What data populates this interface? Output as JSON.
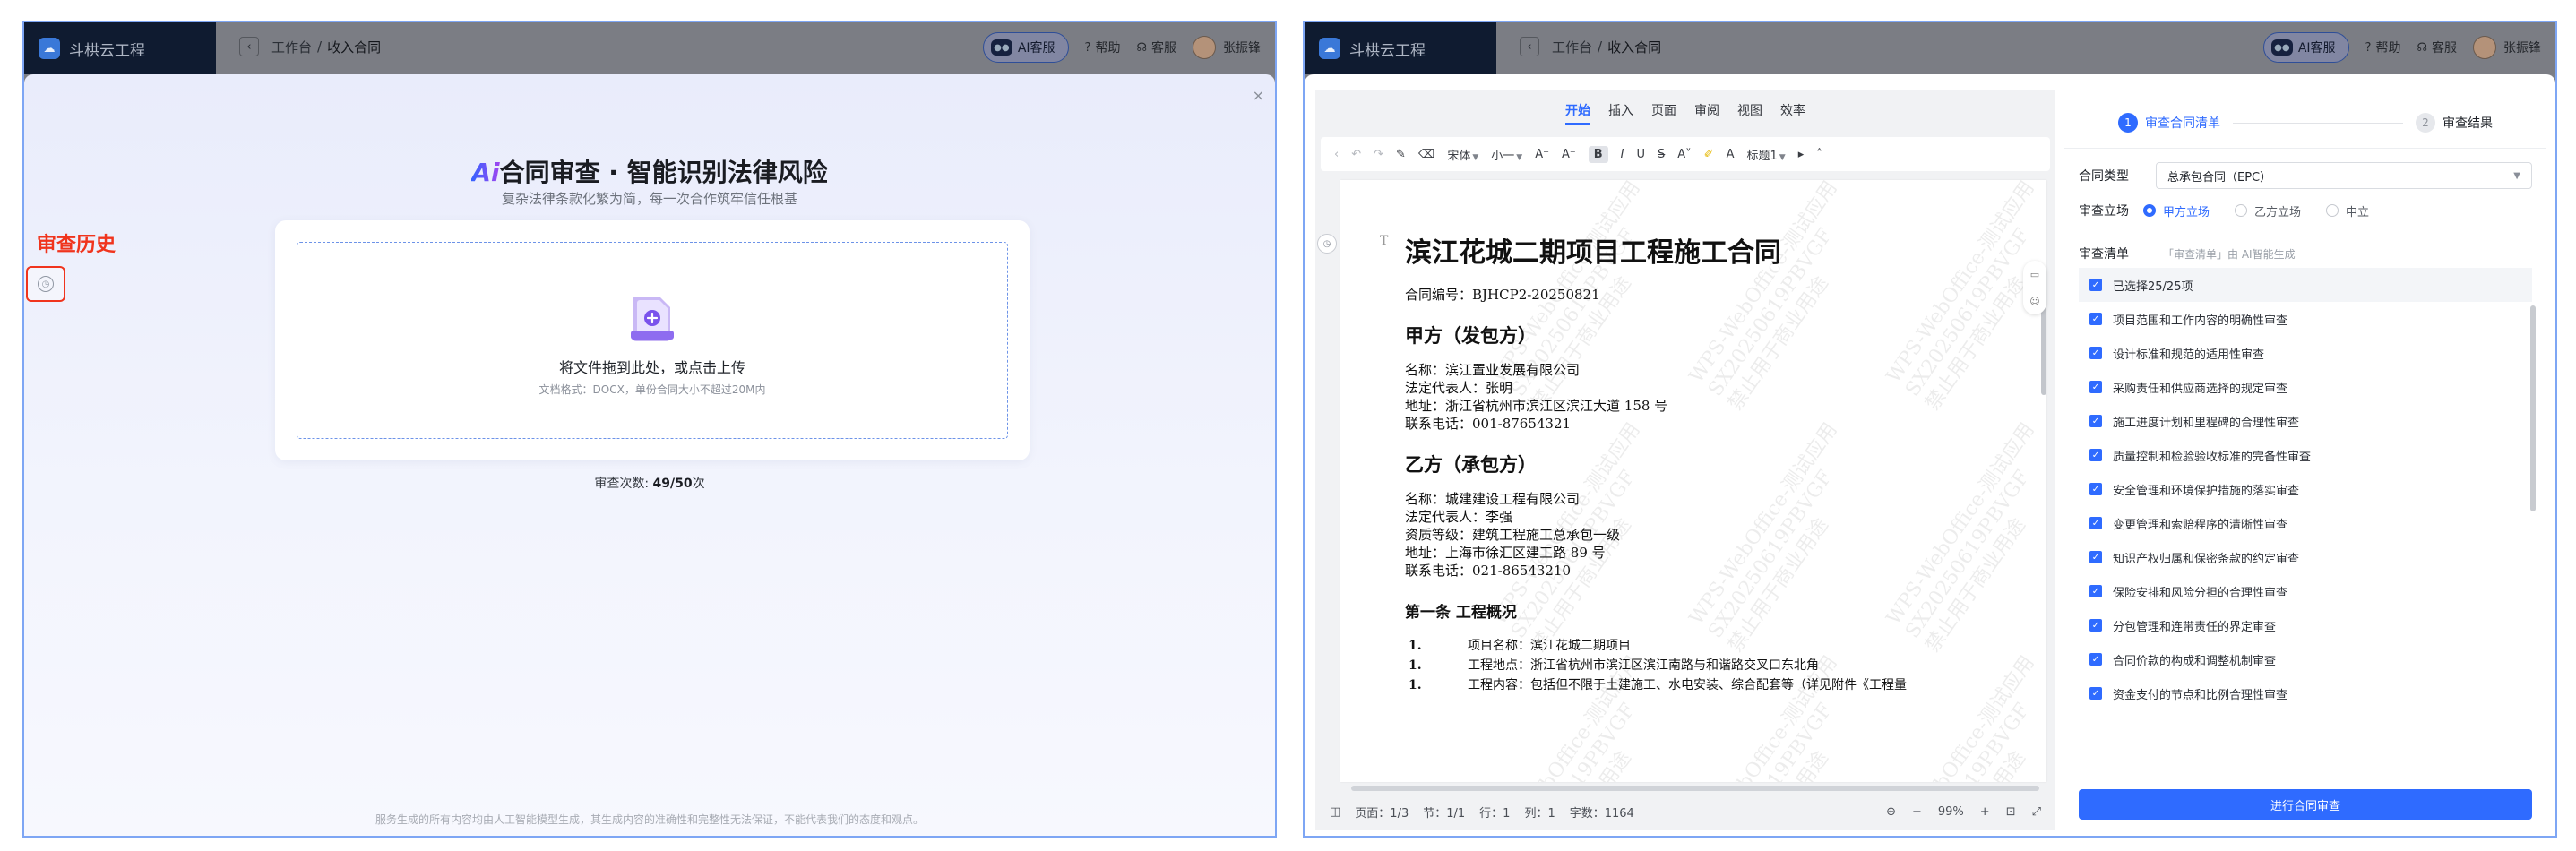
{
  "app": {
    "brand": "斗栱云工程",
    "breadcrumb": [
      "工作台",
      "收入合同"
    ],
    "ai_service": "AI客服",
    "help": "帮助",
    "service": "客服",
    "user": "张振锋"
  },
  "upload_view": {
    "title_ai": "Ai",
    "title_rest": "合同审查 · 智能识别法律风险",
    "subtitle": "复杂法律条款化繁为简，每一次合作筑牢信任根基",
    "history_label": "审查历史",
    "upload_text": "将文件拖到此处，或点击上传",
    "upload_hint": "文档格式：DOCX，单份合同大小不超过20M内",
    "review_count_label": "审查次数: ",
    "review_count_value": "49/50",
    "review_count_unit": "次",
    "footer": "服务生成的所有内容均由人工智能模型生成，其生成内容的准确性和完整性无法保证，不能代表我们的态度和观点。"
  },
  "editor": {
    "tabs": [
      "开始",
      "插入",
      "页面",
      "审阅",
      "视图",
      "效率"
    ],
    "active_tab": "开始",
    "font": "宋体",
    "font_size": "小一",
    "heading": "标题1",
    "watermark": [
      "WPS-WebOffice-测试应用",
      "SX20250619PBVGF",
      "禁止用于商业用途"
    ],
    "doc": {
      "title": "滨江花城二期项目工程施工合同",
      "contract_no": "合同编号：BJHCP2-20250821",
      "party_a_heading": "甲方（发包方）",
      "party_a": [
        "名称：滨江置业发展有限公司",
        "法定代表人：张明",
        "地址：浙江省杭州市滨江区滨江大道 158 号",
        "联系电话：001-87654321"
      ],
      "party_b_heading": "乙方（承包方）",
      "party_b": [
        "名称：城建建设工程有限公司",
        "法定代表人：李强",
        "资质等级：建筑工程施工总承包一级",
        "地址：上海市徐汇区建工路 89 号",
        "联系电话：021-86543210"
      ],
      "article_heading": "第一条 工程概况",
      "article_items": [
        {
          "n": "1.",
          "t": "项目名称：滨江花城二期项目"
        },
        {
          "n": "1.",
          "t": "工程地点：浙江省杭州市滨江区滨江南路与和谐路交叉口东北角"
        },
        {
          "n": "1.",
          "t": "工程内容：包括但不限于土建施工、水电安装、综合配套等（详见附件《工程量"
        }
      ]
    },
    "status": {
      "page": "页面：1/3",
      "section": "节：1/1",
      "row": "行：1",
      "col": "列：1",
      "words": "字数：1164",
      "zoom": "99%"
    }
  },
  "review_panel": {
    "step1": {
      "num": "1",
      "label": "审查合同清单"
    },
    "step2": {
      "num": "2",
      "label": "审查结果"
    },
    "contract_type_label": "合同类型",
    "contract_type_value": "总承包合同（EPC）",
    "position_label": "审查立场",
    "positions": [
      "甲方立场",
      "乙方立场",
      "中立"
    ],
    "selected_position": "甲方立场",
    "list_label": "审查清单",
    "list_hint": "「审查清单」由 AI智能生成",
    "selected_summary": "已选择25/25项",
    "items": [
      "项目范围和工作内容的明确性审查",
      "设计标准和规范的适用性审查",
      "采购责任和供应商选择的规定审查",
      "施工进度计划和里程碑的合理性审查",
      "质量控制和检验验收标准的完备性审查",
      "安全管理和环境保护措施的落实审查",
      "变更管理和索赔程序的清晰性审查",
      "知识产权归属和保密条款的约定审查",
      "保险安排和风险分担的合理性审查",
      "分包管理和连带责任的界定审查",
      "合同价款的构成和调整机制审查",
      "资金支付的节点和比例合理性审查"
    ],
    "submit": "进行合同审查"
  }
}
